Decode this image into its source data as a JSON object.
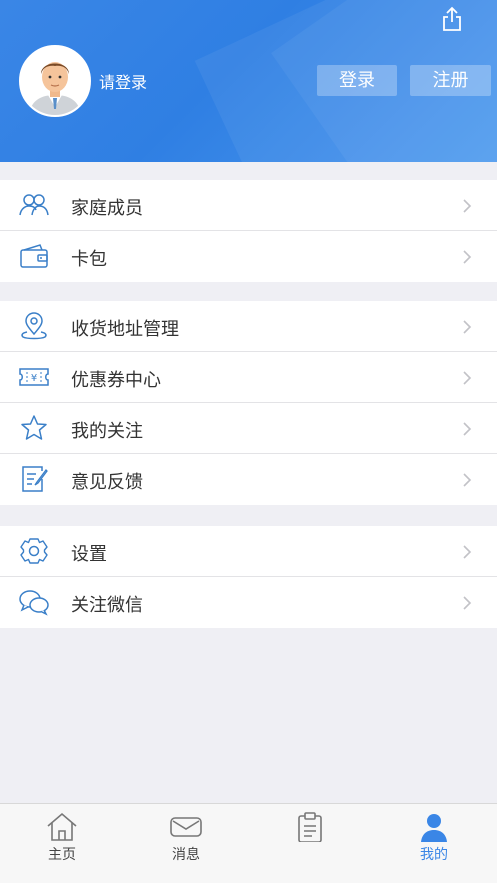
{
  "header": {
    "login_hint": "请登录",
    "login_button": "登录",
    "register_button": "注册"
  },
  "menu_groups": [
    {
      "items": [
        {
          "label": "家庭成员",
          "icon": "family-icon"
        },
        {
          "label": "卡包",
          "icon": "wallet-icon"
        }
      ]
    },
    {
      "items": [
        {
          "label": "收货地址管理",
          "icon": "location-icon"
        },
        {
          "label": "优惠券中心",
          "icon": "coupon-icon"
        },
        {
          "label": "我的关注",
          "icon": "star-icon"
        },
        {
          "label": "意见反馈",
          "icon": "feedback-icon"
        }
      ]
    },
    {
      "items": [
        {
          "label": "设置",
          "icon": "settings-icon"
        },
        {
          "label": "关注微信",
          "icon": "wechat-icon"
        }
      ]
    }
  ],
  "tabbar": {
    "tabs": [
      {
        "label": "主页",
        "icon": "home-icon"
      },
      {
        "label": "消息",
        "icon": "message-icon"
      },
      {
        "label": "",
        "icon": "clipboard-icon"
      },
      {
        "label": "我的",
        "icon": "person-icon"
      }
    ]
  },
  "colors": {
    "brand_blue": "#3a86e6",
    "icon_blue": "#3a7fc8"
  }
}
